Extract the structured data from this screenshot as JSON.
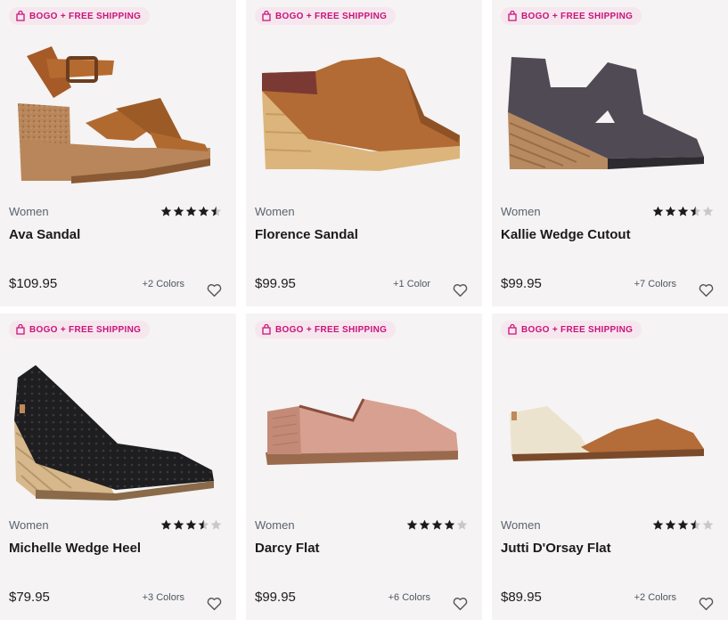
{
  "products": [
    {
      "badge": "BOGO + FREE SHIPPING",
      "category": "Women",
      "name": "Ava Sandal",
      "price": "$109.95",
      "colors": "+2 Colors",
      "rating": 4.5,
      "shoe_type": "sandal-heel"
    },
    {
      "badge": "BOGO + FREE SHIPPING",
      "category": "Women",
      "name": "Florence Sandal",
      "price": "$99.95",
      "colors": "+1 Color",
      "rating": 0,
      "shoe_type": "mule-clog"
    },
    {
      "badge": "BOGO + FREE SHIPPING",
      "category": "Women",
      "name": "Kallie Wedge Cutout",
      "price": "$99.95",
      "colors": "+7 Colors",
      "rating": 3.5,
      "shoe_type": "wedge-bootie"
    },
    {
      "badge": "BOGO + FREE SHIPPING",
      "category": "Women",
      "name": "Michelle Wedge Heel",
      "price": "$79.95",
      "colors": "+3 Colors",
      "rating": 3.5,
      "shoe_type": "espadrille-wedge"
    },
    {
      "badge": "BOGO + FREE SHIPPING",
      "category": "Women",
      "name": "Darcy Flat",
      "price": "$99.95",
      "colors": "+6 Colors",
      "rating": 4,
      "shoe_type": "loafer-flat"
    },
    {
      "badge": "BOGO + FREE SHIPPING",
      "category": "Women",
      "name": "Jutti D'Orsay Flat",
      "price": "$89.95",
      "colors": "+2 Colors",
      "rating": 3.5,
      "shoe_type": "dorsay-flat"
    }
  ],
  "colors": {
    "badge_text": "#c8137a",
    "badge_bg": "#f6e7ee",
    "star_filled": "#1b1b1b",
    "star_empty": "#c8c8c8",
    "card_bg": "#f5f3f3"
  },
  "icons": {
    "badge": "shopping-bag-icon",
    "favorite": "heart-outline-icon",
    "rating": "star-icon"
  }
}
